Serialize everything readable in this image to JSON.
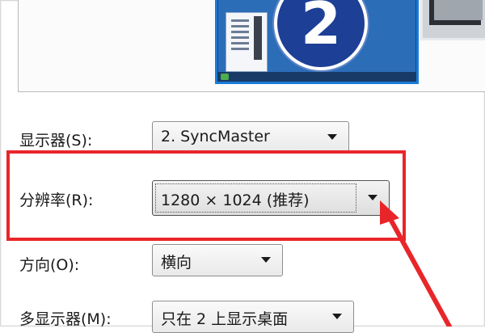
{
  "display_preview": {
    "monitor_number": "2"
  },
  "settings": {
    "display": {
      "label": "显示器(S):",
      "value": "2. SyncMaster"
    },
    "resolution": {
      "label": "分辨率(R):",
      "value": "1280 × 1024 (推荐)"
    },
    "orientation": {
      "label": "方向(O):",
      "value": "横向"
    },
    "multiple_displays": {
      "label": "多显示器(M):",
      "value": "只在 2 上显示桌面"
    }
  },
  "annotation": {
    "highlight_color": "#e8262a"
  }
}
